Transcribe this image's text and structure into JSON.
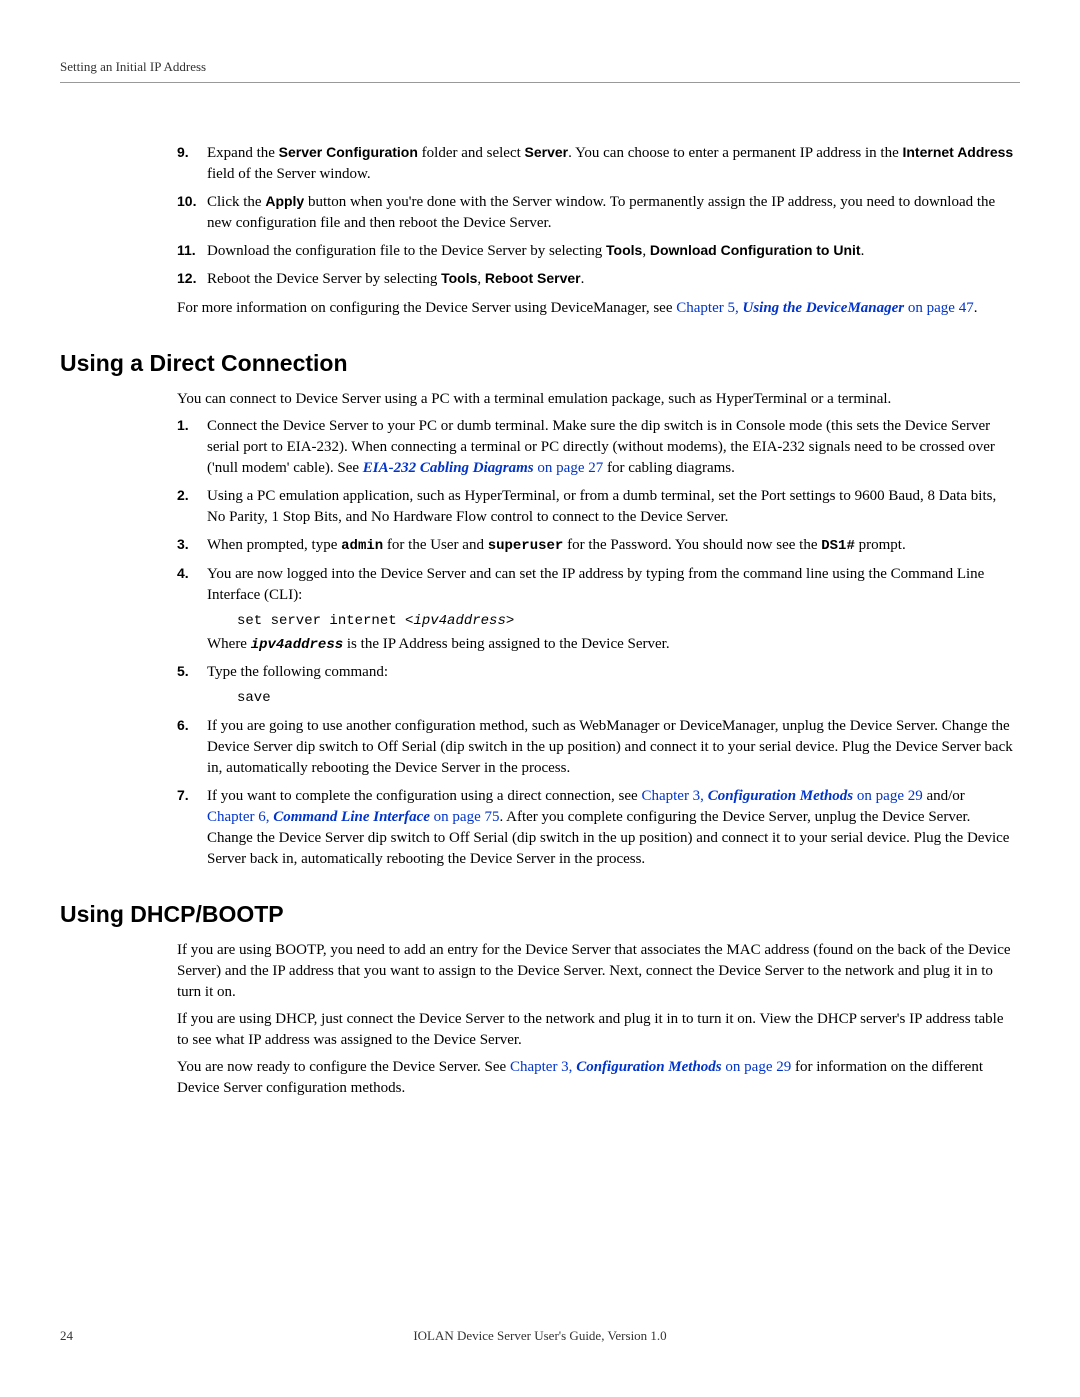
{
  "header": {
    "title": "Setting an Initial IP Address"
  },
  "ol1": {
    "s9_text_a": "Expand the ",
    "s9_bold_a": "Server Configuration",
    "s9_text_b": " folder and select ",
    "s9_bold_b": "Server",
    "s9_text_c": ". You can choose to enter a permanent IP address in the ",
    "s9_bold_c": "Internet Address",
    "s9_text_d": " field of the Server window.",
    "s10_text_a": "Click the ",
    "s10_bold_a": "Apply",
    "s10_text_b": " button when you're done with the Server window. To permanently assign the IP address, you need to download the new configuration file and then reboot the Device Server.",
    "s11_text_a": "Download the configuration file to the Device Server by selecting ",
    "s11_bold_a": "Tools",
    "s11_text_b": ", ",
    "s11_bold_b": "Download Configuration to Unit",
    "s11_text_c": ".",
    "s12_text_a": "Reboot the Device Server by selecting ",
    "s12_bold_a": "Tools",
    "s12_text_b": ", ",
    "s12_bold_b": "Reboot Server",
    "s12_text_c": "."
  },
  "para1": {
    "text_a": "For more information on configuring the Device Server using DeviceManager, see ",
    "link_a": "Chapter 5, ",
    "link_italic_a": "Using the DeviceManager",
    "link_b": " on page 47",
    "text_b": "."
  },
  "h1": "Using a Direct Connection",
  "para2": "You can connect to Device Server using a PC with a terminal emulation package, such as HyperTerminal or a terminal.",
  "ol2": {
    "s1_text_a": "Connect the Device Server to your PC or dumb terminal. Make sure the dip switch is in Console mode (this sets the Device Server serial port to EIA-232). When connecting a terminal or PC directly (without modems), the EIA-232 signals need to be crossed over ('null modem' cable). See ",
    "s1_link_italic": "EIA-232 Cabling Diagrams",
    "s1_link": " on page 27",
    "s1_text_b": " for cabling diagrams.",
    "s2": "Using a PC emulation application, such as HyperTerminal, or from a dumb terminal, set the Port settings to 9600 Baud, 8 Data bits, No Parity, 1 Stop Bits, and No Hardware Flow control to connect to the Device Server.",
    "s3_text_a": "When prompted, type ",
    "s3_mono_a": "admin",
    "s3_text_b": " for the User and ",
    "s3_mono_b": "superuser",
    "s3_text_c": " for the Password. You should now see the ",
    "s3_mono_c": "DS1#",
    "s3_text_d": " prompt.",
    "s4_text_a": "You are now logged into the Device Server and can set the IP address by typing from the command line using the Command Line Interface (CLI):",
    "s4_code_a": "set server internet <",
    "s4_code_italic": "ipv4address",
    "s4_code_b": ">",
    "s4_text_b": "Where ",
    "s4_mono_italic": "ipv4address",
    "s4_text_c": " is the IP Address being assigned to the Device Server.",
    "s5_text": "Type the following command:",
    "s5_code": "save",
    "s6": "If you are going to use another configuration method, such as WebManager or DeviceManager, unplug the Device Server. Change the Device Server dip switch to Off Serial (dip switch in the up position) and connect it to your serial device. Plug the Device Server back in, automatically rebooting the Device Server in the process.",
    "s7_text_a": "If you want to complete the configuration using a direct connection, see ",
    "s7_link_a": "Chapter 3, ",
    "s7_link_italic_a": "Configuration Methods",
    "s7_link_b": " on page 29",
    "s7_text_b": " and/or ",
    "s7_link_c": "Chapter 6, ",
    "s7_link_italic_b": "Command Line Interface",
    "s7_link_d": " on page 75",
    "s7_text_c": ". After you complete configuring the Device Server, unplug the Device Server. Change the Device Server dip switch to Off Serial (dip switch in the up position) and connect it to your serial device. Plug the Device Server back in, automatically rebooting the Device Server in the process."
  },
  "h2": "Using DHCP/BOOTP",
  "para3": "If you are using BOOTP, you need to add an entry for the Device Server that associates the MAC address (found on the back of the Device Server) and the IP address that you want to assign to the Device Server. Next, connect the Device Server to the network and plug it in to turn it on.",
  "para4": "If you are using DHCP, just connect the Device Server to the network and plug it in to turn it on. View the DHCP server's IP address table to see what IP address was assigned to the Device Server.",
  "para5": {
    "text_a": "You are now ready to configure the Device Server. See ",
    "link_a": "Chapter 3, ",
    "link_italic": "Configuration Methods",
    "link_b": " on page 29",
    "text_b": " for information on the different Device Server configuration methods."
  },
  "footer": {
    "pagenum": "24",
    "text": "IOLAN Device Server User's Guide, Version 1.0"
  }
}
